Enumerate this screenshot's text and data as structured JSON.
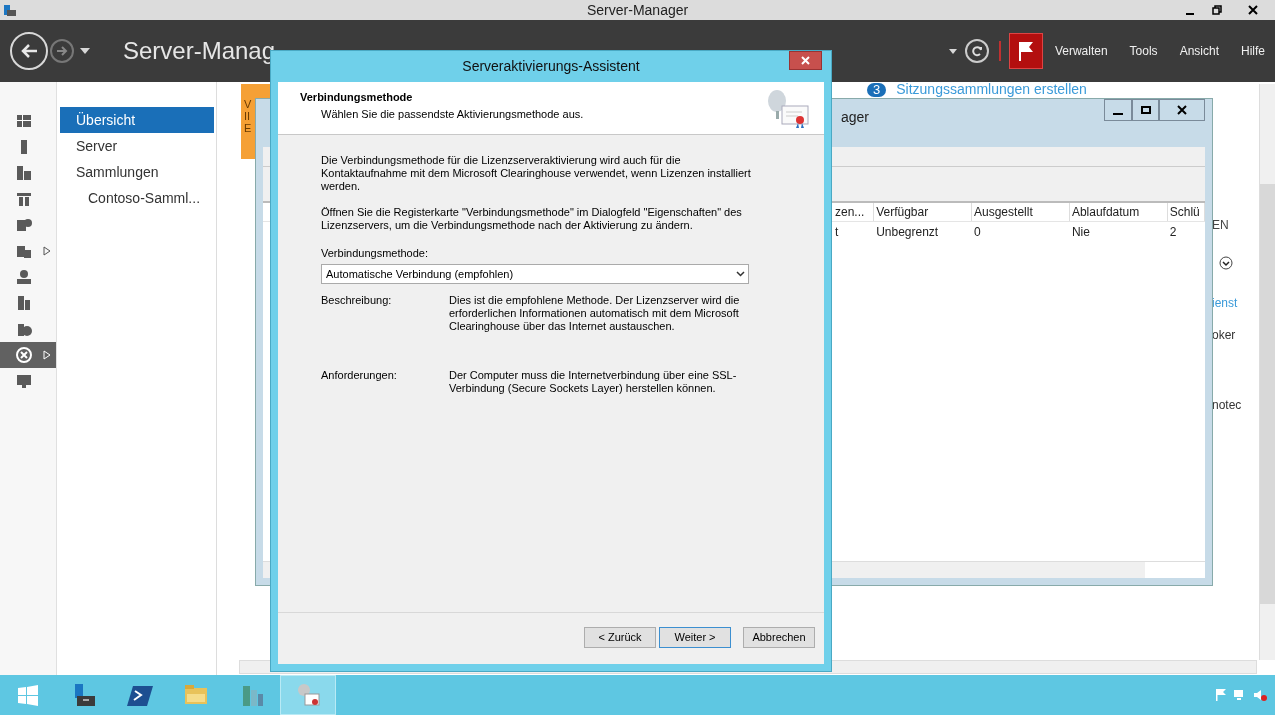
{
  "window": {
    "title": "Server-Manager"
  },
  "header": {
    "breadcrumb": "Server-Manag",
    "menu": [
      "Verwalten",
      "Tools",
      "Ansicht",
      "Hilfe"
    ]
  },
  "rail": [
    {
      "selected": false,
      "expandable": false
    },
    {
      "selected": false,
      "expandable": false
    },
    {
      "selected": false,
      "expandable": false
    },
    {
      "selected": false,
      "expandable": false
    },
    {
      "selected": false,
      "expandable": false
    },
    {
      "selected": false,
      "expandable": true
    },
    {
      "selected": false,
      "expandable": false
    },
    {
      "selected": false,
      "expandable": false
    },
    {
      "selected": false,
      "expandable": false
    },
    {
      "selected": true,
      "expandable": true
    },
    {
      "selected": false,
      "expandable": false
    }
  ],
  "nav": [
    {
      "label": "Übersicht",
      "selected": true
    },
    {
      "label": "Server",
      "selected": false
    },
    {
      "label": "Sammlungen",
      "selected": false,
      "children": [
        {
          "label": "Contoso-Samml...",
          "selected": false
        }
      ]
    }
  ],
  "content": {
    "tile_lines": [
      "V",
      "II",
      "E"
    ],
    "step": {
      "number": "3",
      "label": "Sitzungssammlungen erstellen"
    },
    "side_fragments": [
      "EN",
      "ienst",
      "oker",
      "notec"
    ]
  },
  "license_window": {
    "title": "ager",
    "columns": [
      "zen...",
      "Verfügbar",
      "Ausgestellt",
      "Ablaufdatum",
      "Schlü"
    ],
    "rows": [
      [
        "t",
        "Unbegrenzt",
        "0",
        "Nie",
        "2"
      ]
    ]
  },
  "dialog": {
    "title": "Serveraktivierungs-Assistent",
    "heading": "Verbindungsmethode",
    "subheading": "Wählen Sie die passendste Aktivierungsmethode aus.",
    "paragraphs": [
      "Die Verbindungsmethode für die Lizenzserveraktivierung wird auch für die Kontaktaufnahme mit dem Microsoft Clearinghouse verwendet, wenn Lizenzen installiert werden.",
      "Öffnen Sie die Registerkarte \"Verbindungsmethode\" im Dialogfeld \"Eigenschaften\" des Lizenzservers, um die Verbindungsmethode nach der Aktivierung zu ändern."
    ],
    "field": {
      "label": "Verbindungsmethode:",
      "value": "Automatische Verbindung (empfohlen)"
    },
    "details": [
      {
        "label": "Beschreibung:",
        "text": "Dies ist die empfohlene Methode. Der Lizenzserver wird die erforderlichen Informationen automatisch mit dem Microsoft Clearinghouse über das Internet austauschen."
      },
      {
        "label": "Anforderungen:",
        "text": "Der Computer muss die Internetverbindung über eine SSL-Verbindung (Secure Sockets Layer) herstellen können."
      }
    ],
    "buttons": [
      {
        "label": "< Zurück",
        "default": false
      },
      {
        "label": "Weiter >",
        "default": true
      },
      {
        "label": "Abbrechen",
        "default": false
      }
    ]
  },
  "taskbar": [
    {
      "selected": false
    },
    {
      "selected": false
    },
    {
      "selected": false
    },
    {
      "selected": false
    },
    {
      "selected": false
    },
    {
      "selected": true
    }
  ]
}
